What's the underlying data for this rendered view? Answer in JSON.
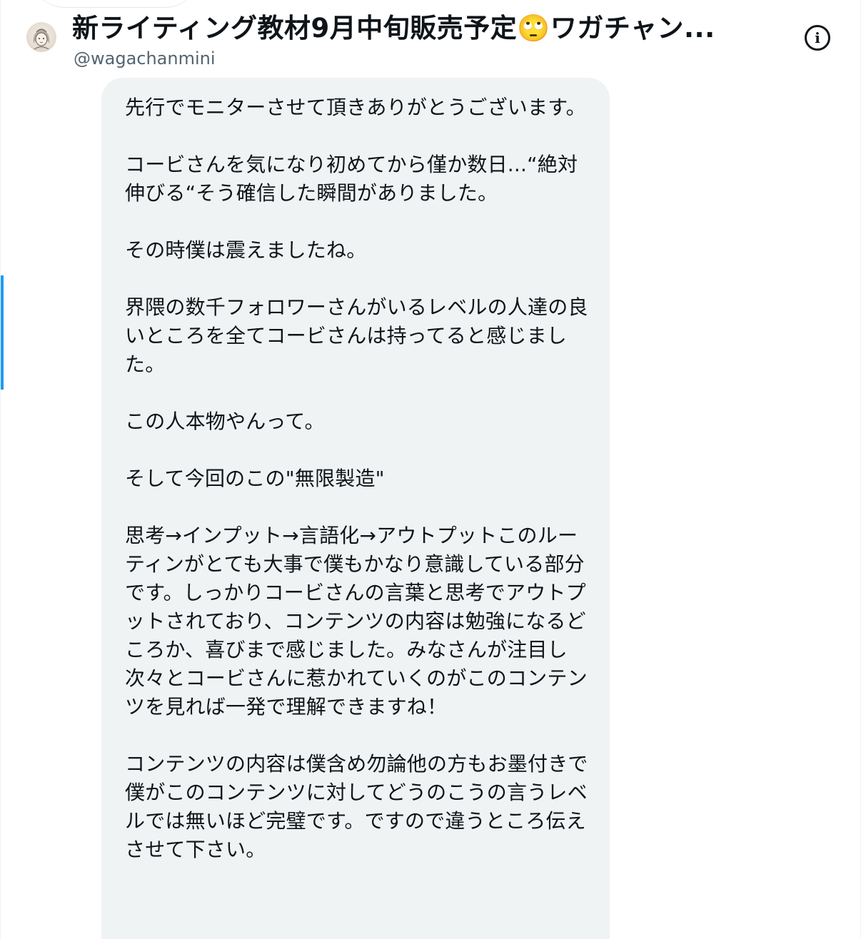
{
  "header": {
    "title": "新ライティング教材9月中旬販売予定🙄ワガチャン...",
    "handle": "@wagachanmini",
    "avatar_icon": "avatar-illustration-icon",
    "info_icon": "info-icon",
    "info_glyph": "i"
  },
  "message": {
    "text": "先行でモニターさせて頂きありがとうございます。\n\nコービさんを気になり初めてから僅か数日...“絶対伸びる“そう確信した瞬間がありました。\n\nその時僕は震えましたね。\n\n界隈の数千フォロワーさんがいるレベルの人達の良いところを全てコービさんは持ってると感じました。\n\nこの人本物やんって。\n\nそして今回のこの\"無限製造\"\n\n思考→インプット→言語化→アウトプットこのルーティンがとても大事で僕もかなり意識している部分です。しっかりコービさんの言葉と思考でアウトプットされており、コンテンツの内容は勉強になるどころか、喜びまで感じました。みなさんが注目し次々とコービさんに惹かれていくのがこのコンテンツを見れば一発で理解できますね！\n\nコンテンツの内容は僕含め勿論他の方もお墨付きで僕がこのコンテンツに対してどうのこうの言うレベルでは無いほど完璧です。ですので違うところ伝えさせて下さい。"
  },
  "colors": {
    "bubble_bg": "#eff3f4",
    "text": "#0f1419",
    "secondary_text": "#536471",
    "accent": "#1d9bf0"
  }
}
